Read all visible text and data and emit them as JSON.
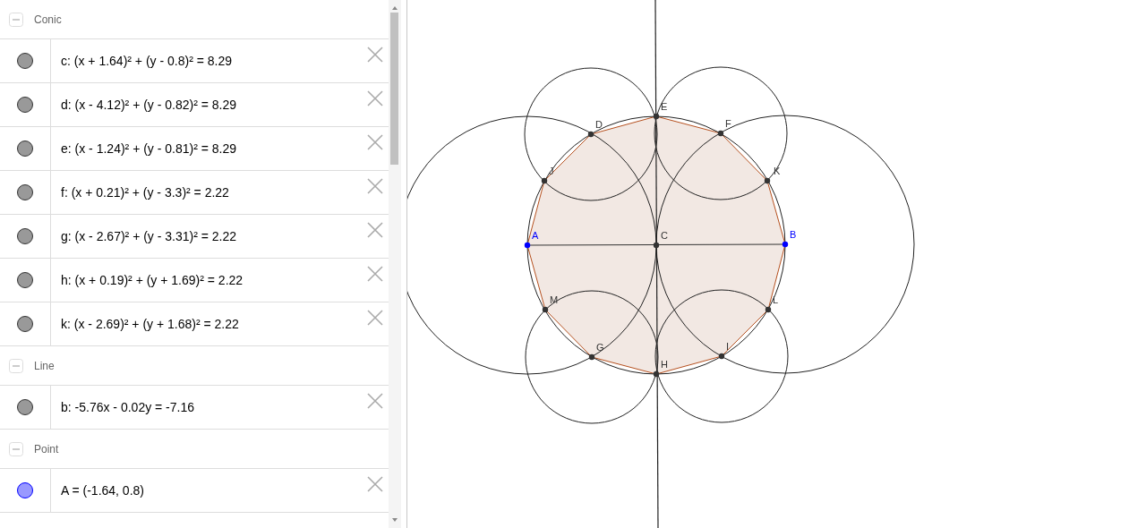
{
  "algebra_view": {
    "groups": [
      {
        "title": "Conic",
        "expanded": true,
        "items": [
          {
            "text": "c: (x + 1.64)² + (y - 0.8)² = 8.29",
            "color": "#999999"
          },
          {
            "text": "d: (x - 4.12)² + (y - 0.82)² = 8.29",
            "color": "#999999"
          },
          {
            "text": "e: (x - 1.24)² + (y - 0.81)² = 8.29",
            "color": "#999999"
          },
          {
            "text": "f: (x + 0.21)² + (y - 3.3)² = 2.22",
            "color": "#999999"
          },
          {
            "text": "g: (x - 2.67)² + (y - 3.31)² = 2.22",
            "color": "#999999"
          },
          {
            "text": "h: (x + 0.19)² + (y + 1.69)² = 2.22",
            "color": "#999999"
          },
          {
            "text": "k: (x - 2.69)² + (y + 1.68)² = 2.22",
            "color": "#999999"
          }
        ]
      },
      {
        "title": "Line",
        "expanded": true,
        "items": [
          {
            "text": "b: -5.76x - 0.02y = -7.16",
            "color": "#999999"
          }
        ]
      },
      {
        "title": "Point",
        "expanded": true,
        "items": [
          {
            "text": "A = (-1.64, 0.8)",
            "color": "#9999ff"
          }
        ]
      }
    ]
  },
  "graphics_view": {
    "points": [
      {
        "label": "D",
        "color": "#333333"
      },
      {
        "label": "E",
        "color": "#333333"
      },
      {
        "label": "F",
        "color": "#333333"
      },
      {
        "label": "J",
        "color": "#333333"
      },
      {
        "label": "K",
        "color": "#333333"
      },
      {
        "label": "A",
        "color": "#0000ff"
      },
      {
        "label": "C",
        "color": "#333333"
      },
      {
        "label": "B",
        "color": "#0000ff"
      },
      {
        "label": "M",
        "color": "#333333"
      },
      {
        "label": "L",
        "color": "#333333"
      },
      {
        "label": "G",
        "color": "#333333"
      },
      {
        "label": "I",
        "color": "#333333"
      },
      {
        "label": "H",
        "color": "#333333"
      }
    ]
  }
}
